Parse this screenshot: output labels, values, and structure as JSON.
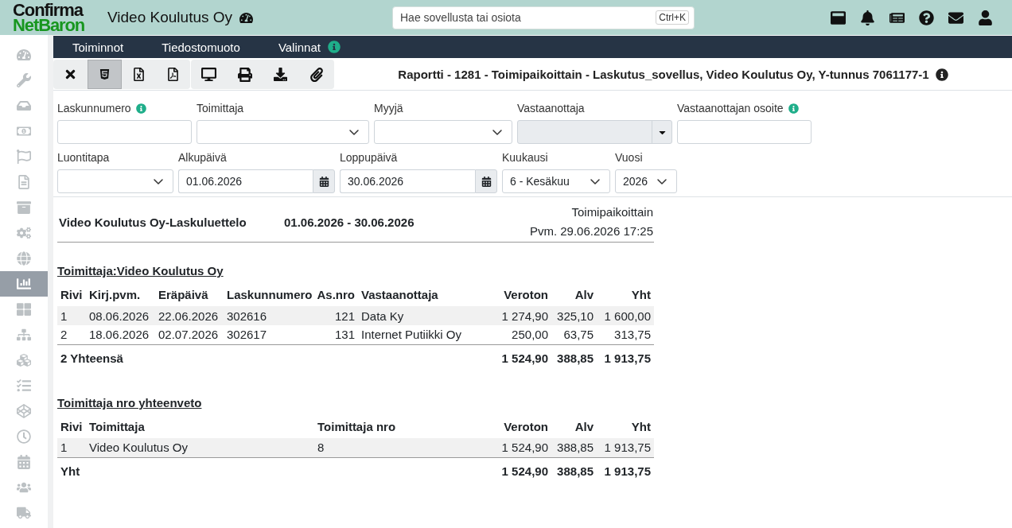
{
  "header": {
    "logo": {
      "line_1": "Confirma",
      "line_2": "NetBaron"
    },
    "company": "Video Koulutus Oy",
    "search": {
      "placeholder": "Hae sovellusta tai osiota",
      "shortcut": "Ctrl+K"
    }
  },
  "sidebar": {
    "items": [
      {
        "selected": false
      },
      {
        "selected": false
      },
      {
        "selected": false
      },
      {
        "selected": false
      },
      {
        "selected": false
      },
      {
        "selected": false
      },
      {
        "selected": false
      },
      {
        "selected": false
      },
      {
        "selected": false
      },
      {
        "selected": true
      },
      {
        "selected": false
      },
      {
        "selected": false
      },
      {
        "selected": false
      },
      {
        "selected": false
      },
      {
        "selected": false
      },
      {
        "selected": false
      },
      {
        "selected": false
      },
      {
        "selected": false
      },
      {
        "selected": false
      }
    ]
  },
  "menubar": {
    "items": [
      {
        "label": "Toiminnot",
        "info": false
      },
      {
        "label": "Tiedostomuoto",
        "info": false
      },
      {
        "label": "Valinnat",
        "info": true
      }
    ]
  },
  "toolbar": {
    "groups": [
      {
        "buttons": [
          {
            "selected": false
          },
          {
            "selected": true
          },
          {
            "selected": false
          },
          {
            "selected": false
          }
        ]
      },
      {
        "buttons": [
          {
            "selected": false
          },
          {
            "selected": false
          },
          {
            "selected": false
          },
          {
            "selected": false
          }
        ]
      }
    ]
  },
  "report_title": {
    "text": "Raportti - 1281 - Toimipaikoittain - Laskutus_sovellus, Video Koulutus Oy, Y-tunnus 7061177-1",
    "info": true
  },
  "filters": {
    "rows": [
      {
        "fields": [
          {
            "label": "Laskunnumero",
            "kind": "text",
            "info": true,
            "disabled": false
          },
          {
            "label": "Toimittaja",
            "kind": "select",
            "info": false,
            "disabled": false
          },
          {
            "label": "Myyjä",
            "kind": "select",
            "info": false,
            "disabled": false
          },
          {
            "label": "Vastaanottaja",
            "kind": "combo",
            "info": false,
            "disabled": true
          },
          {
            "label": "Vastaanottajan osoite",
            "kind": "text",
            "info": true,
            "disabled": false
          }
        ]
      },
      {
        "fields": [
          {
            "label": "Luontitapa",
            "kind": "select",
            "info": false,
            "disabled": false
          },
          {
            "label": "Alkupäivä",
            "kind": "date",
            "value": "01.06.2026",
            "info": false,
            "disabled": false
          },
          {
            "label": "Loppupäivä",
            "kind": "date",
            "value": "30.06.2026",
            "info": false,
            "disabled": false
          },
          {
            "label": "Kuukausi",
            "kind": "select",
            "value": "6 - Kesäkuu",
            "info": false,
            "disabled": false
          },
          {
            "label": "Vuosi",
            "kind": "select",
            "value": "2026",
            "info": false,
            "disabled": false
          }
        ]
      }
    ]
  },
  "report": {
    "title": "Video Koulutus Oy-Laskuluettelo",
    "period": "01.06.2026 - 30.06.2026",
    "grouping": "Toimipaikoittain",
    "printed": "Pvm. 29.06.2026 17:25",
    "sections": [
      {
        "heading": "Toimittaja:Video Koulutus Oy",
        "columns": [
          {
            "label": "Rivi",
            "kind": "text"
          },
          {
            "label": "Kirj.pvm.",
            "kind": "text"
          },
          {
            "label": "Eräpäivä",
            "kind": "text"
          },
          {
            "label": "Laskunnumero",
            "kind": "text"
          },
          {
            "label": "As.nro",
            "kind": "number"
          },
          {
            "label": "Vastaanottaja",
            "kind": "text"
          },
          {
            "label": "Veroton",
            "kind": "number"
          },
          {
            "label": "Alv",
            "kind": "number"
          },
          {
            "label": "Yht",
            "kind": "number"
          }
        ],
        "rows": [
          [
            "1",
            "08.06.2026",
            "22.06.2026",
            "302616",
            "121",
            "Data Ky",
            "1 274,90",
            "325,10",
            "1 600,00"
          ],
          [
            "2",
            "18.06.2026",
            "02.07.2026",
            "302617",
            "131",
            "Internet Putiikki Oy",
            "250,00",
            "63,75",
            "313,75"
          ]
        ],
        "total": {
          "label": "2 Yhteensä",
          "values": [
            "1 524,90",
            "388,85",
            "1 913,75"
          ]
        }
      },
      {
        "heading": "Toimittaja nro yhteenveto",
        "columns": [
          {
            "label": "Rivi",
            "kind": "text"
          },
          {
            "label": "Toimittaja",
            "kind": "text"
          },
          {
            "label": "Toimittaja nro",
            "kind": "text"
          },
          {
            "label": "Veroton",
            "kind": "number"
          },
          {
            "label": "Alv",
            "kind": "number"
          },
          {
            "label": "Yht",
            "kind": "number"
          }
        ],
        "rows": [
          [
            "1",
            "Video Koulutus Oy",
            "8",
            "1 524,90",
            "388,85",
            "1 913,75"
          ]
        ],
        "total": {
          "label": "Yht",
          "values": [
            "1 524,90",
            "388,85",
            "1 913,75"
          ]
        }
      }
    ]
  }
}
